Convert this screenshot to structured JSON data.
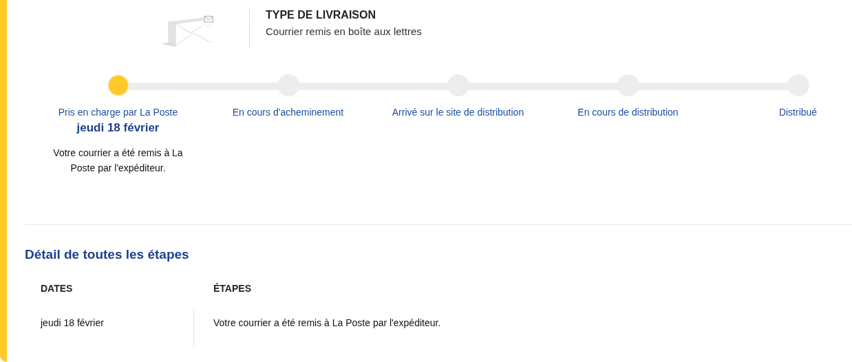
{
  "delivery_type": {
    "title": "TYPE DE LIVRAISON",
    "value": "Courrier remis en boîte aux lettres"
  },
  "steps": [
    {
      "label": "Pris en charge par La Poste",
      "done": true,
      "date": "jeudi 18 février",
      "description": "Votre courrier a été remis à La Poste par l'expéditeur."
    },
    {
      "label": "En cours d'acheminement",
      "done": false
    },
    {
      "label": "Arrivé sur le site de distribution",
      "done": false
    },
    {
      "label": "En cours de distribution",
      "done": false
    },
    {
      "label": "Distribué",
      "done": false
    }
  ],
  "details": {
    "title": "Détail de toutes les étapes",
    "columns": [
      "DATES",
      "ÉTAPES"
    ],
    "rows": [
      [
        "jeudi 18 février",
        "Votre courrier a été remis à La Poste par l'expéditeur."
      ]
    ]
  }
}
